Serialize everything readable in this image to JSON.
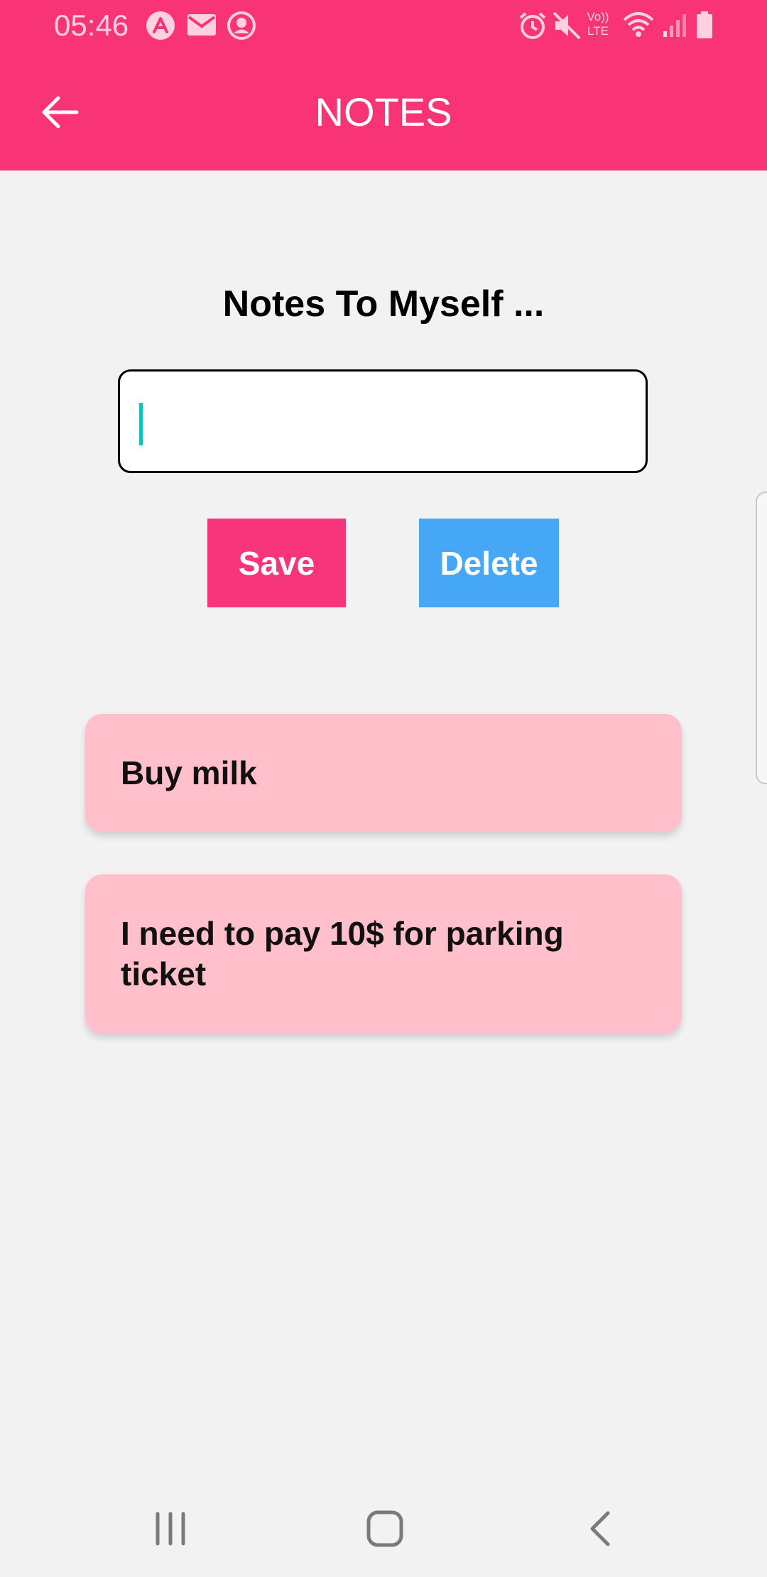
{
  "status_bar": {
    "time": "05:46",
    "left_icons": [
      "app-notification-icon",
      "mail-icon",
      "account-icon"
    ],
    "right_icons": [
      "alarm-icon",
      "mute-icon",
      "volte-icon",
      "wifi-icon",
      "signal-icon",
      "battery-icon"
    ],
    "volte_top": "Vo))",
    "volte_bottom": "LTE"
  },
  "appbar": {
    "title": "NOTES",
    "back_icon": "arrow-left-icon"
  },
  "main": {
    "heading": "Notes To Myself ...",
    "input": {
      "value": "",
      "placeholder": ""
    },
    "save_label": "Save",
    "delete_label": "Delete",
    "notes": [
      {
        "text": "Buy milk"
      },
      {
        "text": "I need to pay 10$ for parking ticket"
      }
    ]
  },
  "colors": {
    "accent": "#f83476",
    "delete": "#46a7f6",
    "note_bg": "#ffbfcb",
    "background": "#f2f2f2"
  },
  "navbar": {
    "icons": [
      "recent-apps-icon",
      "home-icon",
      "back-icon"
    ]
  }
}
